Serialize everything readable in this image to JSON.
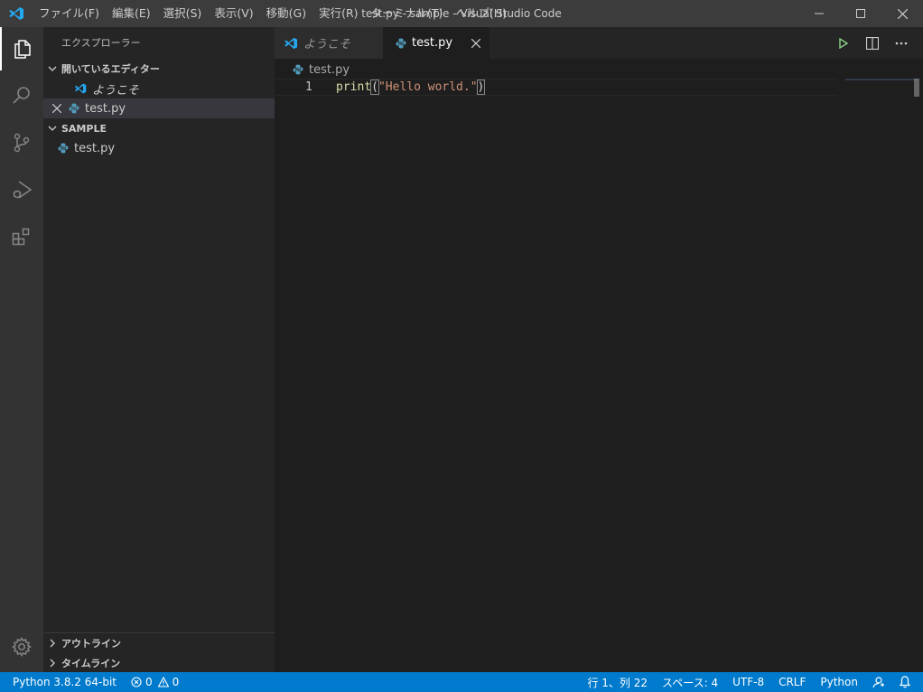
{
  "window": {
    "title": "test.py - sample - Visual Studio Code",
    "menu": [
      "ファイル(F)",
      "編集(E)",
      "選択(S)",
      "表示(V)",
      "移動(G)",
      "実行(R)",
      "ターミナル(T)",
      "ヘルプ(H)"
    ]
  },
  "activity_bar": {
    "items": [
      "explorer-icon",
      "search-icon",
      "source-control-icon",
      "run-debug-icon",
      "extensions-icon"
    ],
    "bottom": "gear-icon"
  },
  "sidebar": {
    "title": "エクスプローラー",
    "open_editors": {
      "header": "開いているエディター",
      "items": [
        {
          "label": "ようこそ",
          "icon": "vscode-icon"
        },
        {
          "label": "test.py",
          "icon": "python-icon"
        }
      ]
    },
    "folder": {
      "header": "SAMPLE",
      "items": [
        {
          "label": "test.py",
          "icon": "python-icon"
        }
      ]
    },
    "outline_header": "アウトライン",
    "timeline_header": "タイムライン"
  },
  "tabs": [
    {
      "label": "ようこそ",
      "icon": "vscode-icon",
      "active": false
    },
    {
      "label": "test.py",
      "icon": "python-icon",
      "active": true
    }
  ],
  "editor": {
    "breadcrumb": "test.py",
    "line_number": "1",
    "code": {
      "fn": "print",
      "open": "(",
      "str": "\"Hello world.\"",
      "close": ")"
    }
  },
  "statusbar": {
    "interpreter": "Python 3.8.2 64-bit",
    "errors": "0",
    "warnings": "0",
    "position": "行 1、列 22",
    "spaces": "スペース: 4",
    "encoding": "UTF-8",
    "eol": "CRLF",
    "language": "Python"
  },
  "colors": {
    "accent": "#007acc",
    "vscode_blue": "#23a9f2",
    "python_blue": "#519aba",
    "run_green": "#89d185"
  }
}
